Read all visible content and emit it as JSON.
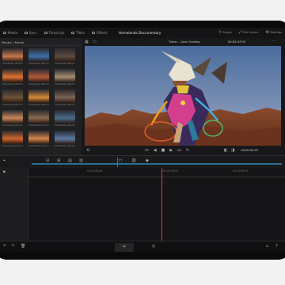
{
  "app": {
    "menu": [
      {
        "icon": "media-icon",
        "label": "Media"
      },
      {
        "icon": "sync-icon",
        "label": "Sync"
      },
      {
        "icon": "transcript-icon",
        "label": "Transcript"
      },
      {
        "icon": "titles-icon",
        "label": "Titles"
      },
      {
        "icon": "effects-icon",
        "label": "Effects"
      }
    ],
    "project_title": "Homelands Documentary",
    "right_menu": [
      {
        "icon": "export-icon",
        "label": "Export"
      },
      {
        "icon": "fullscreen-icon",
        "label": "Full Screen"
      },
      {
        "icon": "settings-icon",
        "label": "Settings"
      }
    ]
  },
  "media_panel": {
    "header": "Master / Media",
    "thumbs": [
      {
        "caption": "Homelands_001.mov",
        "color": "#c4774a"
      },
      {
        "caption": "Homelands_002.mov",
        "color": "#3e6ea8"
      },
      {
        "caption": "Homelands_003.mov",
        "color": "#5b4a3c"
      },
      {
        "caption": "Homelands_004.mov",
        "color": "#e2722f"
      },
      {
        "caption": "Homelands_005.mov",
        "color": "#b45a38"
      },
      {
        "caption": "Homelands_006.mov",
        "color": "#a58c72"
      },
      {
        "caption": "Homelands_007.mov",
        "color": "#6e5232"
      },
      {
        "caption": "Homelands_008.mov",
        "color": "#d78a3a"
      },
      {
        "caption": "Homelands_009.mov",
        "color": "#7a6252"
      },
      {
        "caption": "Homelands_010.mov",
        "color": "#c98658"
      },
      {
        "caption": "Homelands_011.mov",
        "color": "#8a6a4d"
      },
      {
        "caption": "Homelands_012.mov",
        "color": "#4b6b8c"
      },
      {
        "caption": "Homelands_013.mov",
        "color": "#d0662d"
      },
      {
        "caption": "Homelands_014.mov",
        "color": "#d4854a"
      },
      {
        "caption": "Homelands_015.mov",
        "color": "#5a7aa0"
      }
    ]
  },
  "viewer": {
    "clip_title": "Trailer - Color Grading",
    "timecode_top": "00:02:47:05",
    "timecode_bottom": "00:00:54:07"
  },
  "timeline": {
    "ruler_labels": [
      "01:00:00:00",
      "01:00:30:00",
      "01:01:00:00"
    ],
    "playhead_fraction": 0.52
  },
  "bottom": {
    "center_icon": "cut-page-icon"
  }
}
